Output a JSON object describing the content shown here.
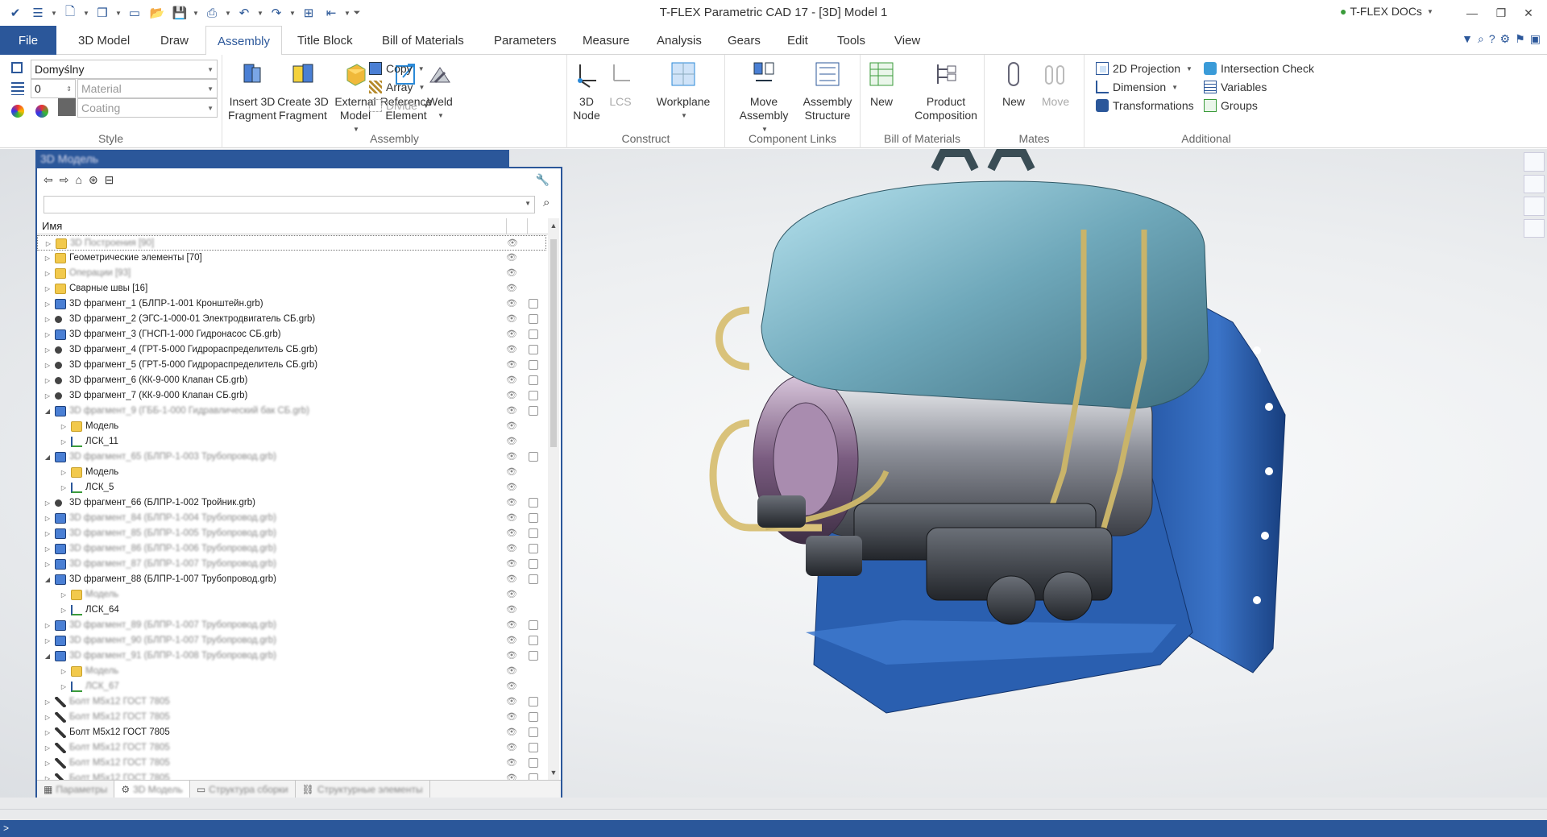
{
  "window": {
    "title": "T-FLEX Parametric CAD 17 - [3D] Model 1",
    "docs_label": "T-FLEX DOCs"
  },
  "tabs": {
    "file": "File",
    "items": [
      "3D Model",
      "Draw",
      "Assembly",
      "Title Block",
      "Bill of Materials",
      "Parameters",
      "Measure",
      "Analysis",
      "Gears",
      "Edit",
      "Tools",
      "View"
    ],
    "active": "Assembly"
  },
  "ribbon": {
    "style": {
      "label": "Style",
      "style_value": "Domyślny",
      "layer_value": "0",
      "material_placeholder": "Material",
      "coating_placeholder": "Coating"
    },
    "assembly": {
      "label": "Assembly",
      "insert_fragment": "Insert 3D Fragment",
      "create_fragment": "Create 3D Fragment",
      "external_model": "External Model",
      "reference_element": "Reference Element",
      "copy": "Copy",
      "array": "Array",
      "divide": "Divide",
      "weld": "Weld"
    },
    "construct": {
      "label": "Construct",
      "node": "3D Node",
      "lcs": "LCS",
      "workplane": "Workplane"
    },
    "component_links": {
      "label": "Component Links",
      "move_assembly": "Move Assembly",
      "assembly_structure": "Assembly Structure"
    },
    "bom": {
      "label": "Bill of Materials",
      "new": "New",
      "product_composition": "Product Composition"
    },
    "mates": {
      "label": "Mates",
      "new": "New",
      "move": "Move"
    },
    "additional": {
      "label": "Additional",
      "projection": "2D Projection",
      "dimension": "Dimension",
      "transformations": "Transformations",
      "intersection": "Intersection Check",
      "variables": "Variables",
      "groups": "Groups"
    }
  },
  "panel": {
    "title": "3D Модель",
    "column_name": "Имя",
    "rows": [
      {
        "t": "3D Построения [90]",
        "lvl": 0,
        "exp": "▷",
        "icon": "folder",
        "blur": true,
        "sel": true,
        "layer": false
      },
      {
        "t": "Геометрические элементы [70]",
        "lvl": 0,
        "exp": "▷",
        "icon": "folder",
        "blur": false,
        "layer": false
      },
      {
        "t": "Операции [93]",
        "lvl": 0,
        "exp": "▷",
        "icon": "folder",
        "blur": true,
        "layer": false
      },
      {
        "t": "Сварные швы [16]",
        "lvl": 0,
        "exp": "▷",
        "icon": "folder",
        "blur": false,
        "layer": false
      },
      {
        "t": "3D фрагмент_1 (БЛПР-1-001 Кронштейн.grb)",
        "lvl": 0,
        "exp": "▷",
        "icon": "frag",
        "blur": false,
        "layer": true
      },
      {
        "t": "3D фрагмент_2 (ЭГС-1-000-01 Электродвигатель СБ.grb)",
        "lvl": 0,
        "exp": "▷",
        "icon": "dot",
        "blur": false,
        "layer": true
      },
      {
        "t": "3D фрагмент_3 (ГНСП-1-000 Гидронасос СБ.grb)",
        "lvl": 0,
        "exp": "▷",
        "icon": "frag",
        "blur": false,
        "layer": true
      },
      {
        "t": "3D фрагмент_4 (ГРТ-5-000 Гидрораспределитель СБ.grb)",
        "lvl": 0,
        "exp": "▷",
        "icon": "dot",
        "blur": false,
        "layer": true
      },
      {
        "t": "3D фрагмент_5 (ГРТ-5-000 Гидрораспределитель СБ.grb)",
        "lvl": 0,
        "exp": "▷",
        "icon": "dot",
        "blur": false,
        "layer": true
      },
      {
        "t": "3D фрагмент_6 (КК-9-000 Клапан СБ.grb)",
        "lvl": 0,
        "exp": "▷",
        "icon": "dot",
        "blur": false,
        "layer": true
      },
      {
        "t": "3D фрагмент_7 (КК-9-000 Клапан СБ.grb)",
        "lvl": 0,
        "exp": "▷",
        "icon": "dot",
        "blur": false,
        "layer": true
      },
      {
        "t": "3D фрагмент_9 (ГББ-1-000 Гидравлический бак СБ.grb)",
        "lvl": 0,
        "exp": "◢",
        "icon": "frag",
        "blur": true,
        "layer": true
      },
      {
        "t": "Модель",
        "lvl": 1,
        "exp": "▷",
        "icon": "folder",
        "blur": false,
        "layer": false
      },
      {
        "t": "ЛСК_11",
        "lvl": 1,
        "exp": "▷",
        "icon": "lcs",
        "blur": false,
        "layer": false
      },
      {
        "t": "3D фрагмент_65 (БЛПР-1-003 Трубопровод.grb)",
        "lvl": 0,
        "exp": "◢",
        "icon": "frag",
        "blur": true,
        "layer": true
      },
      {
        "t": "Модель",
        "lvl": 1,
        "exp": "▷",
        "icon": "folder",
        "blur": false,
        "layer": false
      },
      {
        "t": "ЛСК_5",
        "lvl": 1,
        "exp": "▷",
        "icon": "lcs",
        "blur": false,
        "layer": false
      },
      {
        "t": "3D фрагмент_66 (БЛПР-1-002 Тройник.grb)",
        "lvl": 0,
        "exp": "▷",
        "icon": "dot",
        "blur": false,
        "layer": true
      },
      {
        "t": "3D фрагмент_84 (БЛПР-1-004 Трубопровод.grb)",
        "lvl": 0,
        "exp": "▷",
        "icon": "frag",
        "blur": true,
        "layer": true
      },
      {
        "t": "3D фрагмент_85 (БЛПР-1-005 Трубопровод.grb)",
        "lvl": 0,
        "exp": "▷",
        "icon": "frag",
        "blur": true,
        "layer": true
      },
      {
        "t": "3D фрагмент_86 (БЛПР-1-006 Трубопровод.grb)",
        "lvl": 0,
        "exp": "▷",
        "icon": "frag",
        "blur": true,
        "layer": true
      },
      {
        "t": "3D фрагмент_87 (БЛПР-1-007 Трубопровод.grb)",
        "lvl": 0,
        "exp": "▷",
        "icon": "frag",
        "blur": true,
        "layer": true
      },
      {
        "t": "3D фрагмент_88 (БЛПР-1-007 Трубопровод.grb)",
        "lvl": 0,
        "exp": "◢",
        "icon": "frag",
        "blur": false,
        "layer": true
      },
      {
        "t": "Модель",
        "lvl": 1,
        "exp": "▷",
        "icon": "folder",
        "blur": true,
        "layer": false
      },
      {
        "t": "ЛСК_64",
        "lvl": 1,
        "exp": "▷",
        "icon": "lcs",
        "blur": false,
        "layer": false
      },
      {
        "t": "3D фрагмент_89 (БЛПР-1-007 Трубопровод.grb)",
        "lvl": 0,
        "exp": "▷",
        "icon": "frag",
        "blur": true,
        "layer": true
      },
      {
        "t": "3D фрагмент_90 (БЛПР-1-007 Трубопровод.grb)",
        "lvl": 0,
        "exp": "▷",
        "icon": "frag",
        "blur": true,
        "layer": true
      },
      {
        "t": "3D фрагмент_91 (БЛПР-1-008 Трубопровод.grb)",
        "lvl": 0,
        "exp": "◢",
        "icon": "frag",
        "blur": true,
        "layer": true
      },
      {
        "t": "Модель",
        "lvl": 1,
        "exp": "▷",
        "icon": "folder",
        "blur": true,
        "layer": false
      },
      {
        "t": "ЛСК_67",
        "lvl": 1,
        "exp": "▷",
        "icon": "lcs",
        "blur": true,
        "layer": false
      },
      {
        "t": "Болт М5х12 ГОСТ 7805",
        "lvl": 0,
        "exp": "▷",
        "icon": "bolt",
        "blur": true,
        "layer": true
      },
      {
        "t": "Болт М5х12 ГОСТ 7805",
        "lvl": 0,
        "exp": "▷",
        "icon": "bolt",
        "blur": true,
        "layer": true
      },
      {
        "t": "Болт М5х12 ГОСТ 7805",
        "lvl": 0,
        "exp": "▷",
        "icon": "bolt",
        "blur": false,
        "layer": true
      },
      {
        "t": "Болт М5х12 ГОСТ 7805",
        "lvl": 0,
        "exp": "▷",
        "icon": "bolt",
        "blur": true,
        "layer": true
      },
      {
        "t": "Болт М5х12 ГОСТ 7805",
        "lvl": 0,
        "exp": "▷",
        "icon": "bolt",
        "blur": true,
        "layer": true
      },
      {
        "t": "Болт М5х12 ГОСТ 7805",
        "lvl": 0,
        "exp": "▷",
        "icon": "bolt",
        "blur": true,
        "layer": true
      }
    ],
    "bottom_tabs": [
      "Параметры",
      "3D Модель",
      "Структура сборки",
      "Структурные элементы"
    ]
  },
  "status": {
    "text": ">"
  },
  "colors": {
    "accent": "#2b579a",
    "folder": "#f2c94c",
    "tank": "#7fb7c7",
    "frame": "#2c5fa8",
    "motor": "#8a6d8f"
  }
}
